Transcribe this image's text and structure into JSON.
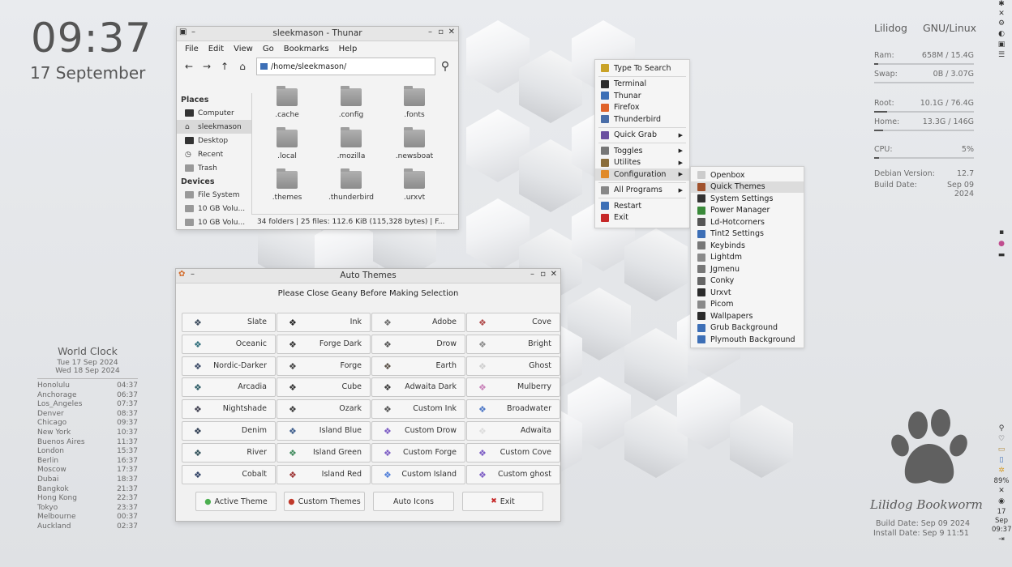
{
  "clock": {
    "time": "09:37",
    "date": "17 September"
  },
  "sysinfo": {
    "user": "Lilidog",
    "os": "GNU/Linux",
    "ram_label": "Ram:",
    "ram_value": "658M / 15.4G",
    "ram_fraction": 0.04,
    "swap_label": "Swap:",
    "swap_value": "0B / 3.07G",
    "swap_fraction": 0.0,
    "root_label": "Root:",
    "root_value": "10.1G / 76.4G",
    "root_fraction": 0.13,
    "home_label": "Home:",
    "home_value": "13.3G / 146G",
    "home_fraction": 0.09,
    "cpu_label": "CPU:",
    "cpu_value": "5%",
    "cpu_fraction": 0.05,
    "debian_label": "Debian Version:",
    "debian_value": "12.7",
    "build_label": "Build Date:",
    "build_value": "Sep 09 2024"
  },
  "thunar": {
    "title": "sleekmason - Thunar",
    "menu": [
      "File",
      "Edit",
      "View",
      "Go",
      "Bookmarks",
      "Help"
    ],
    "address": "/home/sleekmason/",
    "places_header": "Places",
    "places": [
      "Computer",
      "sleekmason",
      "Desktop",
      "Recent",
      "Trash"
    ],
    "devices_header": "Devices",
    "devices": [
      "File System",
      "10 GB Volu...",
      "10 GB Volu..."
    ],
    "folders": [
      ".cache",
      ".config",
      ".fonts",
      ".local",
      ".mozilla",
      ".newsboat",
      ".themes",
      ".thunderbird",
      ".urxvt"
    ],
    "status": "34 folders  |  25 files: 112.6 KiB (115,328 bytes)  |  F..."
  },
  "menu": {
    "items": [
      {
        "label": "Type To Search",
        "color": "#c9a227"
      },
      {
        "label": "Terminal",
        "color": "#2b2b2b"
      },
      {
        "label": "Thunar",
        "color": "#3d6fb6"
      },
      {
        "label": "Firefox",
        "color": "#e0632a"
      },
      {
        "label": "Thunderbird",
        "color": "#4a6ea8"
      },
      {
        "label": "Quick Grab",
        "color": "#6b4fa0"
      },
      {
        "label": "Toggles",
        "color": "#777777"
      },
      {
        "label": "Utilites",
        "color": "#8a6d3b"
      },
      {
        "label": "Configuration",
        "color": "#e08a2a"
      },
      {
        "label": "All Programs",
        "color": "#888888"
      },
      {
        "label": "Restart",
        "color": "#3d6fb6"
      },
      {
        "label": "Exit",
        "color": "#c62828"
      }
    ],
    "submenu": [
      "Openbox",
      "Quick Themes",
      "System Settings",
      "Power Manager",
      "Ld-Hotcorners",
      "Tint2 Settings",
      "Keybinds",
      "Lightdm",
      "Jgmenu",
      "Conky",
      "Urxvt",
      "Picom",
      "Wallpapers",
      "Grub Background",
      "Plymouth Background"
    ]
  },
  "autothemes": {
    "title": "Auto Themes",
    "notice": "Please Close Geany Before Making Selection",
    "themes": [
      {
        "label": "Slate",
        "color": "#3a4a5c"
      },
      {
        "label": "Ink",
        "color": "#222222"
      },
      {
        "label": "Adobe",
        "color": "#6b6b6b"
      },
      {
        "label": "Cove",
        "color": "#b04a4a"
      },
      {
        "label": "Oceanic",
        "color": "#2e6d7a"
      },
      {
        "label": "Forge Dark",
        "color": "#333333"
      },
      {
        "label": "Drow",
        "color": "#555555"
      },
      {
        "label": "Bright",
        "color": "#8c8c8c"
      },
      {
        "label": "Nordic-Darker",
        "color": "#3b4a66"
      },
      {
        "label": "Forge",
        "color": "#444444"
      },
      {
        "label": "Earth",
        "color": "#5a5148"
      },
      {
        "label": "Ghost",
        "color": "#cfcfcf"
      },
      {
        "label": "Arcadia",
        "color": "#2d5c66"
      },
      {
        "label": "Cube",
        "color": "#333333"
      },
      {
        "label": "Adwaita Dark",
        "color": "#3c3c3c"
      },
      {
        "label": "Mulberry",
        "color": "#c983b9"
      },
      {
        "label": "Nightshade",
        "color": "#3f3f4f"
      },
      {
        "label": "Ozark",
        "color": "#3b3b3b"
      },
      {
        "label": "Custom Ink",
        "color": "#555555"
      },
      {
        "label": "Broadwater",
        "color": "#4f79c7"
      },
      {
        "label": "Denim",
        "color": "#2f3d52"
      },
      {
        "label": "Island Blue",
        "color": "#3d5d8c"
      },
      {
        "label": "Custom Drow",
        "color": "#7c5cc4"
      },
      {
        "label": "Adwaita",
        "color": "#dddddd"
      },
      {
        "label": "River",
        "color": "#2f4f58"
      },
      {
        "label": "Island Green",
        "color": "#3f8a5c"
      },
      {
        "label": "Custom Forge",
        "color": "#7c5cc4"
      },
      {
        "label": "Custom Cove",
        "color": "#7c5cc4"
      },
      {
        "label": "Cobalt",
        "color": "#2d3f63"
      },
      {
        "label": "Island Red",
        "color": "#9c3232"
      },
      {
        "label": "Custom Island",
        "color": "#4f7ed9"
      },
      {
        "label": "Custom ghost",
        "color": "#7c5cc4"
      }
    ],
    "bottom": {
      "active": "Active Theme",
      "custom": "Custom Themes",
      "icons": "Auto Icons",
      "exit": "Exit"
    }
  },
  "worldclock": {
    "title": "World Clock",
    "date1": "Tue 17 Sep 2024",
    "date2": "Wed 18 Sep 2024",
    "rows": [
      [
        "Honolulu",
        "04:37"
      ],
      [
        "Anchorage",
        "06:37"
      ],
      [
        "Los_Angeles",
        "07:37"
      ],
      [
        "Denver",
        "08:37"
      ],
      [
        "Chicago",
        "09:37"
      ],
      [
        "New York",
        "10:37"
      ],
      [
        "Buenos Aires",
        "11:37"
      ],
      [
        "London",
        "15:37"
      ],
      [
        "Berlin",
        "16:37"
      ],
      [
        "Moscow",
        "17:37"
      ],
      [
        "Dubai",
        "18:37"
      ],
      [
        "Bangkok",
        "21:37"
      ],
      [
        "Hong Kong",
        "22:37"
      ],
      [
        "Tokyo",
        "23:37"
      ],
      [
        "Melbourne",
        "00:37"
      ],
      [
        "Auckland",
        "02:37"
      ]
    ]
  },
  "brand": {
    "name": "Lilidog Bookworm",
    "build": "Build Date: Sep 09 2024",
    "install": "Install Date: Sep  9 11:51"
  },
  "dock": {
    "battery": "89%",
    "day": "17",
    "month": "Sep",
    "time": "09:37"
  }
}
